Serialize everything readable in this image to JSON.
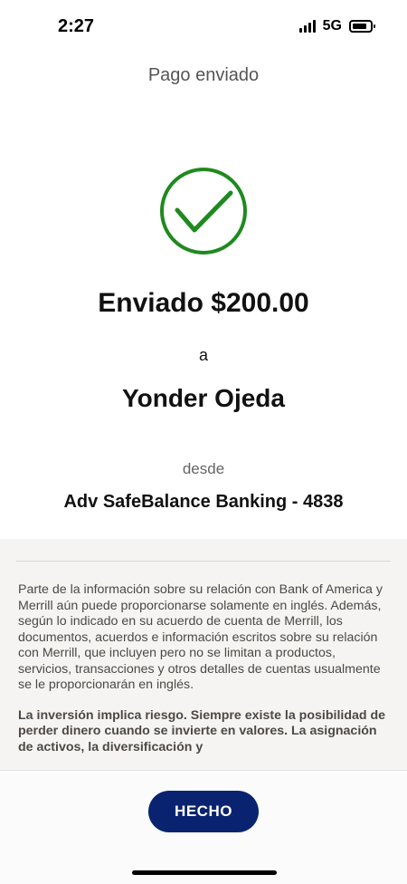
{
  "status_bar": {
    "time": "2:27",
    "network": "5G"
  },
  "header": {
    "title": "Pago enviado"
  },
  "confirmation": {
    "icon": "checkmark-circle-icon",
    "amount_text": "Enviado $200.00",
    "to_word": "a",
    "recipient": "Yonder Ojeda",
    "from_word": "desde",
    "account": "Adv SafeBalance Banking - 4838"
  },
  "disclaimer": {
    "paragraph1": "Parte de la información sobre su relación con Bank of America y Merrill aún puede proporcionarse solamente en inglés. Además, según lo indicado en su acuerdo de cuenta de Merrill, los documentos, acuerdos e información escritos sobre su relación con Merrill, que incluyen pero no se limitan a productos, servicios, transacciones y otros detalles de cuentas usualmente se le proporcionarán en inglés.",
    "paragraph2": "La inversión implica riesgo. Siempre existe la posibilidad de perder dinero cuando se invierte en valores. La asignación de activos, la diversificación y"
  },
  "actions": {
    "done_label": "HECHO"
  },
  "colors": {
    "success_green": "#1f8a1f",
    "button_navy": "#0a2370"
  }
}
